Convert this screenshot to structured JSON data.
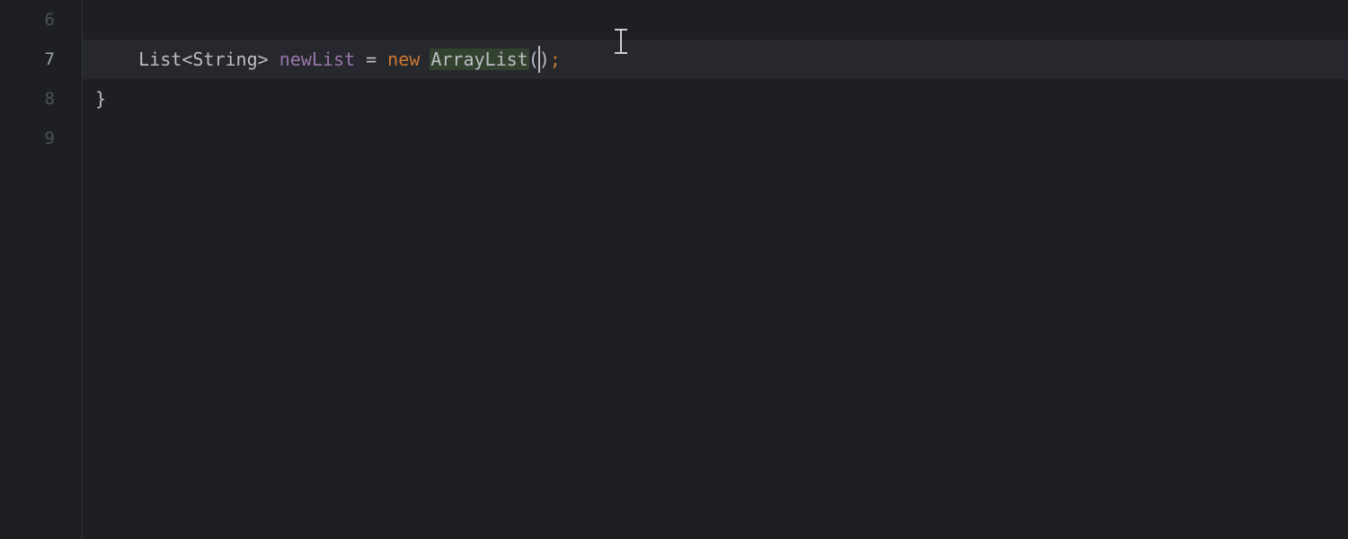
{
  "editor": {
    "lines": [
      {
        "num": "6",
        "active": false
      },
      {
        "num": "7",
        "active": true
      },
      {
        "num": "8",
        "active": false
      },
      {
        "num": "9",
        "active": false
      }
    ],
    "line7": {
      "indent": "    ",
      "type1": "List",
      "lt": "<",
      "generic": "String",
      "gt": ">",
      "space1": " ",
      "varname": "newList",
      "space2": " ",
      "eq": "=",
      "space3": " ",
      "kw_new": "new",
      "space4": " ",
      "type2": "ArrayList",
      "parens": "()",
      "semi": ";"
    },
    "line8": {
      "brace": "}"
    }
  }
}
